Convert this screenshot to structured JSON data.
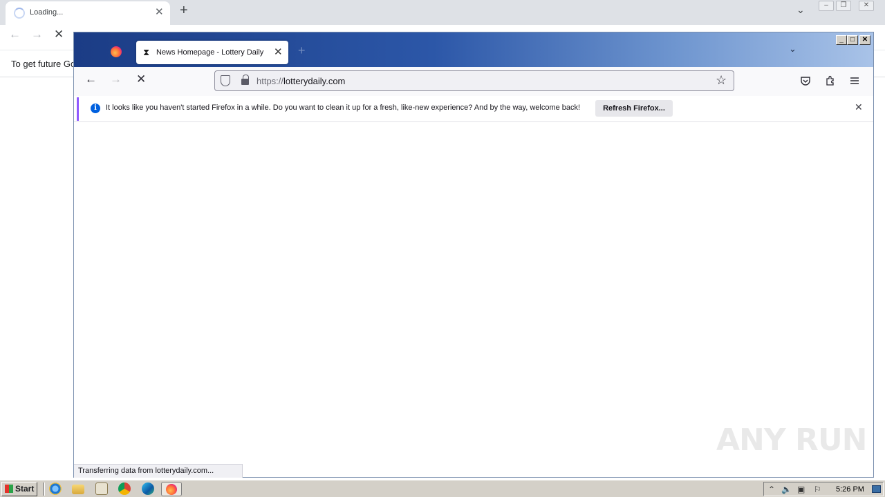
{
  "chrome": {
    "tab_title": "Loading...",
    "infobar_text": "To get future Go"
  },
  "firefox": {
    "tab_title": "News Homepage - Lottery Daily",
    "url_protocol": "https://",
    "url_host": "lotterydaily.com",
    "notification_text": "It looks like you haven't started Firefox in a while. Do you want to clean it up for a fresh, like-new experience? And by the way, welcome back!",
    "refresh_button_label": "Refresh Firefox...",
    "status_text": "Transferring data from lotterydaily.com..."
  },
  "watermark": "ANY RUN",
  "taskbar": {
    "start_label": "Start",
    "clock": "5:26 PM"
  }
}
